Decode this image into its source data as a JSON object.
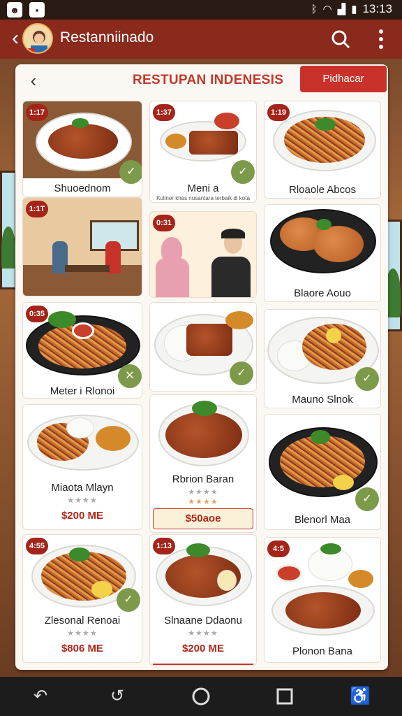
{
  "status_bar": {
    "time": "13:13",
    "icons": [
      "app-icon",
      "image-icon",
      "bluetooth-icon",
      "wifi-icon",
      "signal-icon",
      "battery-icon"
    ]
  },
  "app_bar": {
    "title": "Restanniinado",
    "back_icon": "back-arrow-icon",
    "search_icon": "search-icon",
    "more_icon": "more-vert-icon"
  },
  "panel": {
    "title": "RESTUPAN INDENESIS",
    "back_icon": "back-chevron-icon",
    "cta_label": "Pidhacar"
  },
  "colors": {
    "brand": "#8a2a1c",
    "accent": "#c8322a",
    "fab": "#7d9a4a",
    "panel": "#fbf7f2"
  },
  "tiles": [
    {
      "badge": "1:17",
      "name": "Shuoednom",
      "fab": "check-icon"
    },
    {
      "badge": "1:37",
      "name": "Meni a",
      "sub": "Kuliner khas nusantara terbaik di kota",
      "fab": "check-icon"
    },
    {
      "badge": "1:19",
      "name": "Rloaole Abcos"
    },
    {
      "badge": "1:1T"
    },
    {
      "badge": "0:31"
    },
    {
      "name": "Blaore Aouo"
    },
    {
      "badge": "0:35",
      "name": "Meter i Rlonoi",
      "fab": "close-icon"
    },
    {
      "fab": "check-icon"
    },
    {
      "name": "Mauno Slnok",
      "fab": "check-icon"
    },
    {
      "name": "Miaota Mlayn",
      "stars": "★★★★",
      "price": "$200 ME"
    },
    {
      "name": "Rbrion Baran",
      "stars": "★★★★",
      "price": "$50aoe"
    },
    {
      "name": "Blenorl Maa",
      "fab": "check-icon"
    },
    {
      "badge": "4:55",
      "name": "Zlesonal Renoai",
      "stars": "★★★★",
      "price": "$806 ME",
      "fab": "check-icon"
    },
    {
      "badge": "1:13",
      "name": "Slnaane Ddaonu",
      "stars": "★★★★",
      "price": "$200 ME"
    },
    {
      "badge": "4:5",
      "name": "Plonon Bana"
    }
  ],
  "nav_bar": {
    "icons": [
      "back-gesture-icon",
      "undo-icon",
      "home-icon",
      "recents-icon",
      "accessibility-icon"
    ]
  }
}
